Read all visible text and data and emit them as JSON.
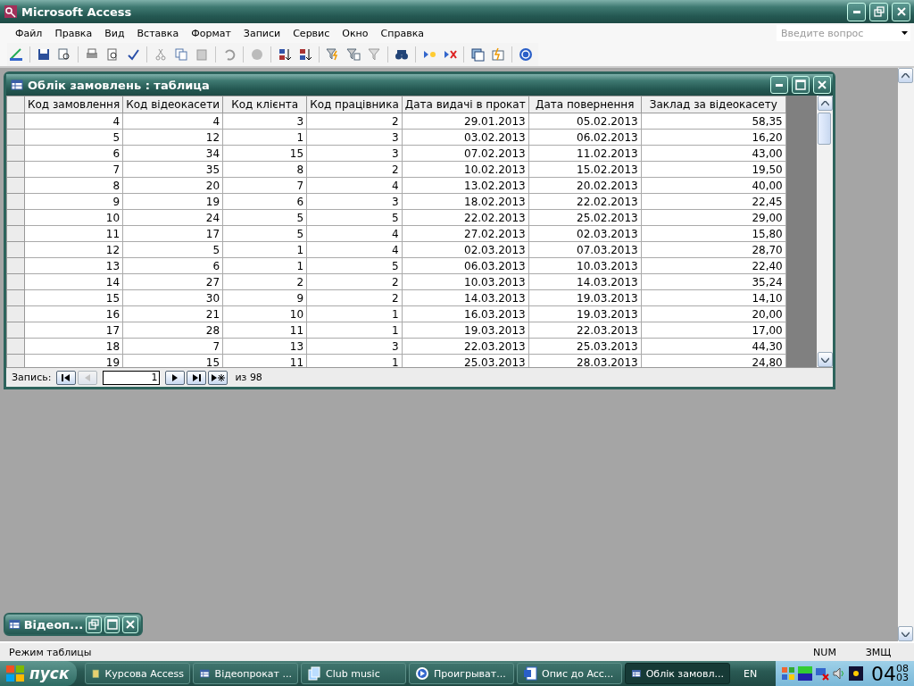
{
  "window": {
    "title": "Microsoft Access"
  },
  "menu": [
    "Файл",
    "Правка",
    "Вид",
    "Вставка",
    "Формат",
    "Записи",
    "Сервис",
    "Окно",
    "Справка"
  ],
  "help_box": {
    "placeholder": "Введите вопрос"
  },
  "table_window": {
    "title": "Облік замовлень : таблица",
    "columns": [
      "Код замовлення",
      "Код відеокасети",
      "Код клієнта",
      "Код працівника",
      "Дата видачі в прокат",
      "Дата повернення",
      "Заклад за відеокасету"
    ],
    "rows": [
      [
        "4",
        "4",
        "3",
        "2",
        "29.01.2013",
        "05.02.2013",
        "58,35"
      ],
      [
        "5",
        "12",
        "1",
        "3",
        "03.02.2013",
        "06.02.2013",
        "16,20"
      ],
      [
        "6",
        "34",
        "15",
        "3",
        "07.02.2013",
        "11.02.2013",
        "43,00"
      ],
      [
        "7",
        "35",
        "8",
        "2",
        "10.02.2013",
        "15.02.2013",
        "19,50"
      ],
      [
        "8",
        "20",
        "7",
        "4",
        "13.02.2013",
        "20.02.2013",
        "40,00"
      ],
      [
        "9",
        "19",
        "6",
        "3",
        "18.02.2013",
        "22.02.2013",
        "22,45"
      ],
      [
        "10",
        "24",
        "5",
        "5",
        "22.02.2013",
        "25.02.2013",
        "29,00"
      ],
      [
        "11",
        "17",
        "5",
        "4",
        "27.02.2013",
        "02.03.2013",
        "15,80"
      ],
      [
        "12",
        "5",
        "1",
        "4",
        "02.03.2013",
        "07.03.2013",
        "28,70"
      ],
      [
        "13",
        "6",
        "1",
        "5",
        "06.03.2013",
        "10.03.2013",
        "22,40"
      ],
      [
        "14",
        "27",
        "2",
        "2",
        "10.03.2013",
        "14.03.2013",
        "35,24"
      ],
      [
        "15",
        "30",
        "9",
        "2",
        "14.03.2013",
        "19.03.2013",
        "14,10"
      ],
      [
        "16",
        "21",
        "10",
        "1",
        "16.03.2013",
        "19.03.2013",
        "20,00"
      ],
      [
        "17",
        "28",
        "11",
        "1",
        "19.03.2013",
        "22.03.2013",
        "17,00"
      ],
      [
        "18",
        "7",
        "13",
        "3",
        "22.03.2013",
        "25.03.2013",
        "44,30"
      ],
      [
        "19",
        "15",
        "11",
        "1",
        "25.03.2013",
        "28.03.2013",
        "24,80"
      ]
    ],
    "navigator": {
      "label": "Запись:",
      "record": "1",
      "of": "из",
      "total": "98"
    }
  },
  "minimized_window": {
    "title": "Відеоп..."
  },
  "status_bar": {
    "mode": "Режим таблицы",
    "num": "NUM",
    "ovr": "ЗМЩ"
  },
  "taskbar": {
    "start": "пуск",
    "items": [
      {
        "kind": "folder",
        "label": "Курсова Access",
        "selected": false
      },
      {
        "kind": "table",
        "label": "Відеопрокат ...",
        "selected": false
      },
      {
        "kind": "windows",
        "label": "Club music",
        "selected": false
      },
      {
        "kind": "player",
        "label": "Проигрыват...",
        "selected": false
      },
      {
        "kind": "word",
        "label": "Опис до Acc...",
        "selected": false
      },
      {
        "kind": "table",
        "label": "Облік замовл...",
        "selected": true
      }
    ],
    "language": "EN",
    "clock": {
      "hour": "04",
      "minute": "08",
      "second": "03"
    }
  }
}
